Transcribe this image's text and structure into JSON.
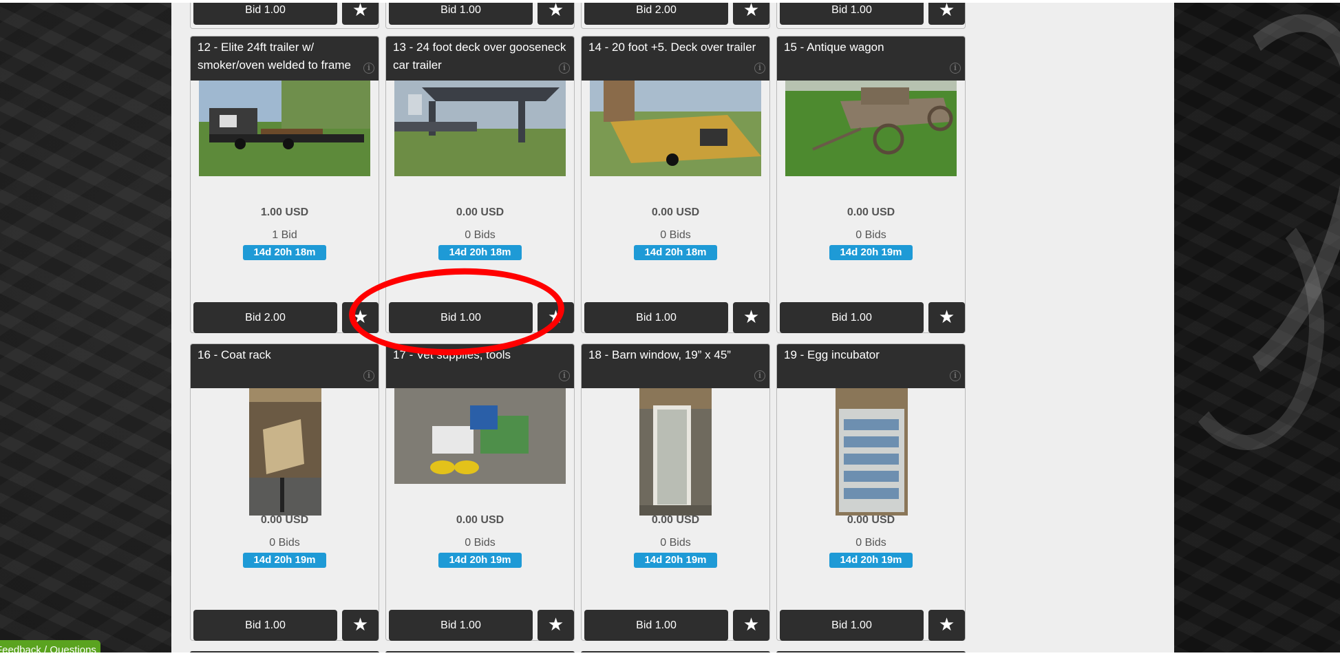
{
  "colors": {
    "header_bg": "#2e2e2e",
    "timer_bg": "#1e9ad6",
    "annotation": "#ff0000",
    "feedback_bg": "#5aa31f"
  },
  "top_row": [
    {
      "bid_label": "Bid 1.00"
    },
    {
      "bid_label": "Bid 1.00"
    },
    {
      "bid_label": "Bid 2.00"
    },
    {
      "bid_label": "Bid 1.00"
    }
  ],
  "lots": [
    {
      "title": "12 - Elite 24ft trailer w/ smoker/oven welded to frame",
      "price": "1.00 USD",
      "bids": "1 Bid",
      "time_left": "14d 20h 18m",
      "bid_label": "Bid 2.00",
      "image": "trailer-with-smoker"
    },
    {
      "title": "13 - 24 foot deck over gooseneck car trailer",
      "price": "0.00 USD",
      "bids": "0 Bids",
      "time_left": "14d 20h 18m",
      "bid_label": "Bid 1.00",
      "image": "gooseneck-trailer"
    },
    {
      "title": "14 - 20 foot +5. Deck over trailer",
      "price": "0.00 USD",
      "bids": "0 Bids",
      "time_left": "14d 20h 18m",
      "bid_label": "Bid 1.00",
      "image": "deck-over-trailer"
    },
    {
      "title": "15 - Antique wagon",
      "price": "0.00 USD",
      "bids": "0 Bids",
      "time_left": "14d 20h 19m",
      "bid_label": "Bid 1.00",
      "image": "antique-wagon"
    },
    {
      "title": "16 - Coat rack",
      "price": "0.00 USD",
      "bids": "0 Bids",
      "time_left": "14d 20h 19m",
      "bid_label": "Bid 1.00",
      "image": "coat-rack"
    },
    {
      "title": "17 - Vet supplies, tools",
      "price": "0.00 USD",
      "bids": "0 Bids",
      "time_left": "14d 20h 19m",
      "bid_label": "Bid 1.00",
      "image": "vet-supplies"
    },
    {
      "title": "18 - Barn window, 19” x 45”",
      "price": "0.00 USD",
      "bids": "0 Bids",
      "time_left": "14d 20h 19m",
      "bid_label": "Bid 1.00",
      "image": "barn-window"
    },
    {
      "title": "19 - Egg incubator",
      "price": "0.00 USD",
      "bids": "0 Bids",
      "time_left": "14d 20h 19m",
      "bid_label": "Bid 1.00",
      "image": "egg-incubator"
    }
  ],
  "feedback_label": "Feedback / Questions",
  "icons": {
    "star": "★",
    "info": "i"
  }
}
